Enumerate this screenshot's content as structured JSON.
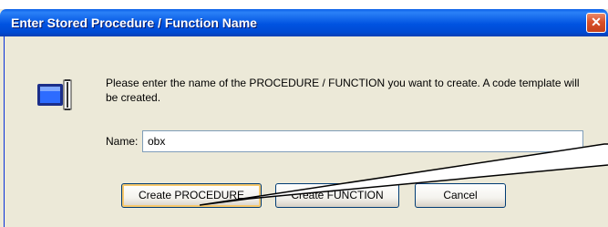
{
  "window": {
    "title": "Enter Stored Procedure / Function Name",
    "close_glyph": "✕"
  },
  "message": "Please enter the name of the PROCEDURE / FUNCTION you want to create. A code template will be created.",
  "name_field": {
    "label": "Name:",
    "value": "obx"
  },
  "buttons": {
    "create_procedure": "Create PROCEDURE",
    "create_function": "Create FUNCTION",
    "cancel": "Cancel"
  },
  "colors": {
    "titlebar": "#0053e1",
    "dialog_bg": "#ece9d8",
    "close": "#d9502a",
    "default_button_focus": "#f7c86c"
  },
  "icons": [
    "procedure-icon",
    "close-icon"
  ]
}
